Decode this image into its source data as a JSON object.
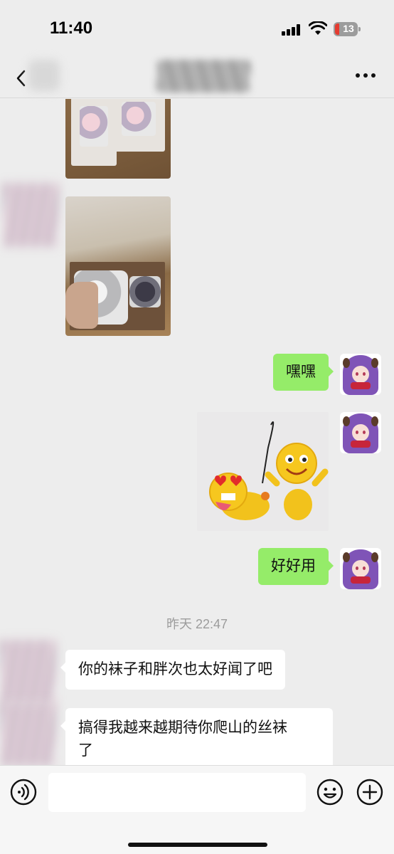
{
  "status_bar": {
    "time": "11:40",
    "battery_level": "13",
    "battery_color": "#e53b30"
  },
  "nav": {
    "back_icon": "chevron-left-icon",
    "more_icon": "ellipsis-icon"
  },
  "messages": [
    {
      "from": "them",
      "type": "image",
      "description_icon": "photo"
    },
    {
      "from": "them",
      "type": "image",
      "description_icon": "photo"
    },
    {
      "from": "me",
      "type": "text",
      "text": "嘿嘿"
    },
    {
      "from": "me",
      "type": "sticker",
      "description_icon": "emoji-sticker"
    },
    {
      "from": "me",
      "type": "text",
      "text": "好好用"
    },
    {
      "from": "them",
      "type": "text",
      "text": "你的袜子和胖次也太好闻了吧"
    },
    {
      "from": "them",
      "type": "text",
      "text": "搞得我越来越期待你爬山的丝袜\n了"
    }
  ],
  "timestamp": "昨天 22:47",
  "input_bar": {
    "voice_icon": "voice-icon",
    "emoji_icon": "emoji-icon",
    "plus_icon": "plus-icon",
    "input_value": ""
  },
  "colors": {
    "background": "#ededed",
    "my_bubble": "#95ec69",
    "their_bubble": "#ffffff"
  }
}
